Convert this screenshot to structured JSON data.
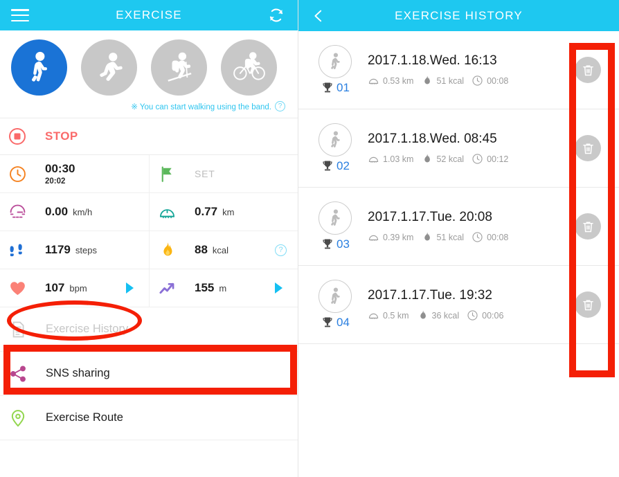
{
  "left": {
    "header": {
      "title": "EXERCISE",
      "menu_icon": "hamburger-icon",
      "refresh_icon": "refresh-sync-icon"
    },
    "activities": [
      {
        "name": "walking",
        "label": "Walking",
        "active": true
      },
      {
        "name": "running",
        "label": "Running",
        "active": false
      },
      {
        "name": "hiking",
        "label": "Hiking",
        "active": false
      },
      {
        "name": "cycling",
        "label": "Cycling",
        "active": false
      }
    ],
    "hint": {
      "text": "※ You can start walking using the band.",
      "help_icon": "?"
    },
    "stop": {
      "label": "STOP",
      "icon": "stop-record-icon"
    },
    "stats": [
      {
        "icon": "clock-icon",
        "value": "00:30",
        "sub": "20:02",
        "unit": "",
        "type": "duration"
      },
      {
        "icon": "flag-icon",
        "value": "SET",
        "unit": "",
        "type": "goal"
      },
      {
        "icon": "speedometer-icon",
        "value": "0.00",
        "unit": "km/h",
        "type": "speed"
      },
      {
        "icon": "odometer-icon",
        "value": "0.77",
        "unit": "km",
        "type": "distance"
      },
      {
        "icon": "footsteps-icon",
        "value": "1179",
        "unit": "steps",
        "type": "steps"
      },
      {
        "icon": "flame-icon",
        "value": "88",
        "unit": "kcal",
        "type": "calories",
        "help": "?"
      },
      {
        "icon": "heart-icon",
        "value": "107",
        "unit": "bpm",
        "type": "heartrate"
      },
      {
        "icon": "trend-arrow-icon",
        "value": "155",
        "unit": "m",
        "type": "elevation"
      }
    ],
    "menu": [
      {
        "icon": "document-list-icon",
        "label": "Exercise History",
        "muted": true
      },
      {
        "icon": "share-icon",
        "label": "SNS sharing",
        "muted": false
      },
      {
        "icon": "location-pin-icon",
        "label": "Exercise Route",
        "muted": false
      }
    ]
  },
  "right": {
    "header": {
      "title": "EXERCISE HISTORY",
      "back_icon": "back-chevron-icon"
    },
    "rows": [
      {
        "rank": "01",
        "date": "2017.1.18.Wed. 16:13",
        "distance": "0.53 km",
        "calories": "51 kcal",
        "duration": "00:08",
        "activity_icon": "walking-icon",
        "delete_icon": "trash-icon"
      },
      {
        "rank": "02",
        "date": "2017.1.18.Wed. 08:45",
        "distance": "1.03 km",
        "calories": "52 kcal",
        "duration": "00:12",
        "activity_icon": "walking-icon",
        "delete_icon": "trash-icon"
      },
      {
        "rank": "03",
        "date": "2017.1.17.Tue. 20:08",
        "distance": "0.39 km",
        "calories": "51 kcal",
        "duration": "00:08",
        "activity_icon": "walking-icon",
        "delete_icon": "trash-icon"
      },
      {
        "rank": "04",
        "date": "2017.1.17.Tue. 19:32",
        "distance": "0.5 km",
        "calories": "36 kcal",
        "duration": "00:06",
        "activity_icon": "walking-icon",
        "delete_icon": "trash-icon"
      }
    ]
  },
  "colors": {
    "header_blue": "#1ec8f0",
    "active_blue": "#1a73d6",
    "annotation_red": "#f41f06",
    "stop_red": "#fa6a6a",
    "rank_blue": "#2a7fe0",
    "arrow_blue": "#15c0f2"
  }
}
